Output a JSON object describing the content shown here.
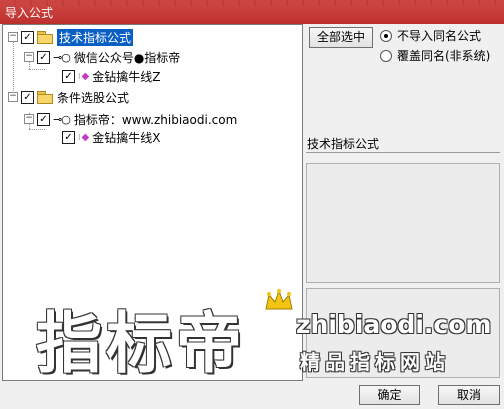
{
  "window": {
    "title": "导入公式"
  },
  "tree": {
    "nodes": [
      {
        "label": "技术指标公式",
        "checked": true,
        "selected": true
      },
      {
        "label": "微信公众号●指标帝",
        "checked": true
      },
      {
        "label": "金钻擒牛线Z",
        "checked": true
      },
      {
        "label": "条件选股公式",
        "checked": true
      },
      {
        "label": "指标帝：www.zhibiaodi.com",
        "checked": true
      },
      {
        "label": "金钻擒牛线X",
        "checked": true
      }
    ]
  },
  "options": {
    "select_all_label": "全部选中",
    "radio_skip_label": "不导入同名公式",
    "radio_overwrite_label": "覆盖同名(非系统)",
    "selected": "skip"
  },
  "details": {
    "label": "技术指标公式"
  },
  "buttons": {
    "ok": "确定",
    "cancel": "取消"
  },
  "watermark": {
    "logo": "指标帝",
    "site": "zhibiaodi.com",
    "slogan": "精品指标网站"
  },
  "colors": {
    "titlebar": "#c23b38",
    "selection": "#0a5fc4",
    "diamond": "#c23cc2"
  }
}
